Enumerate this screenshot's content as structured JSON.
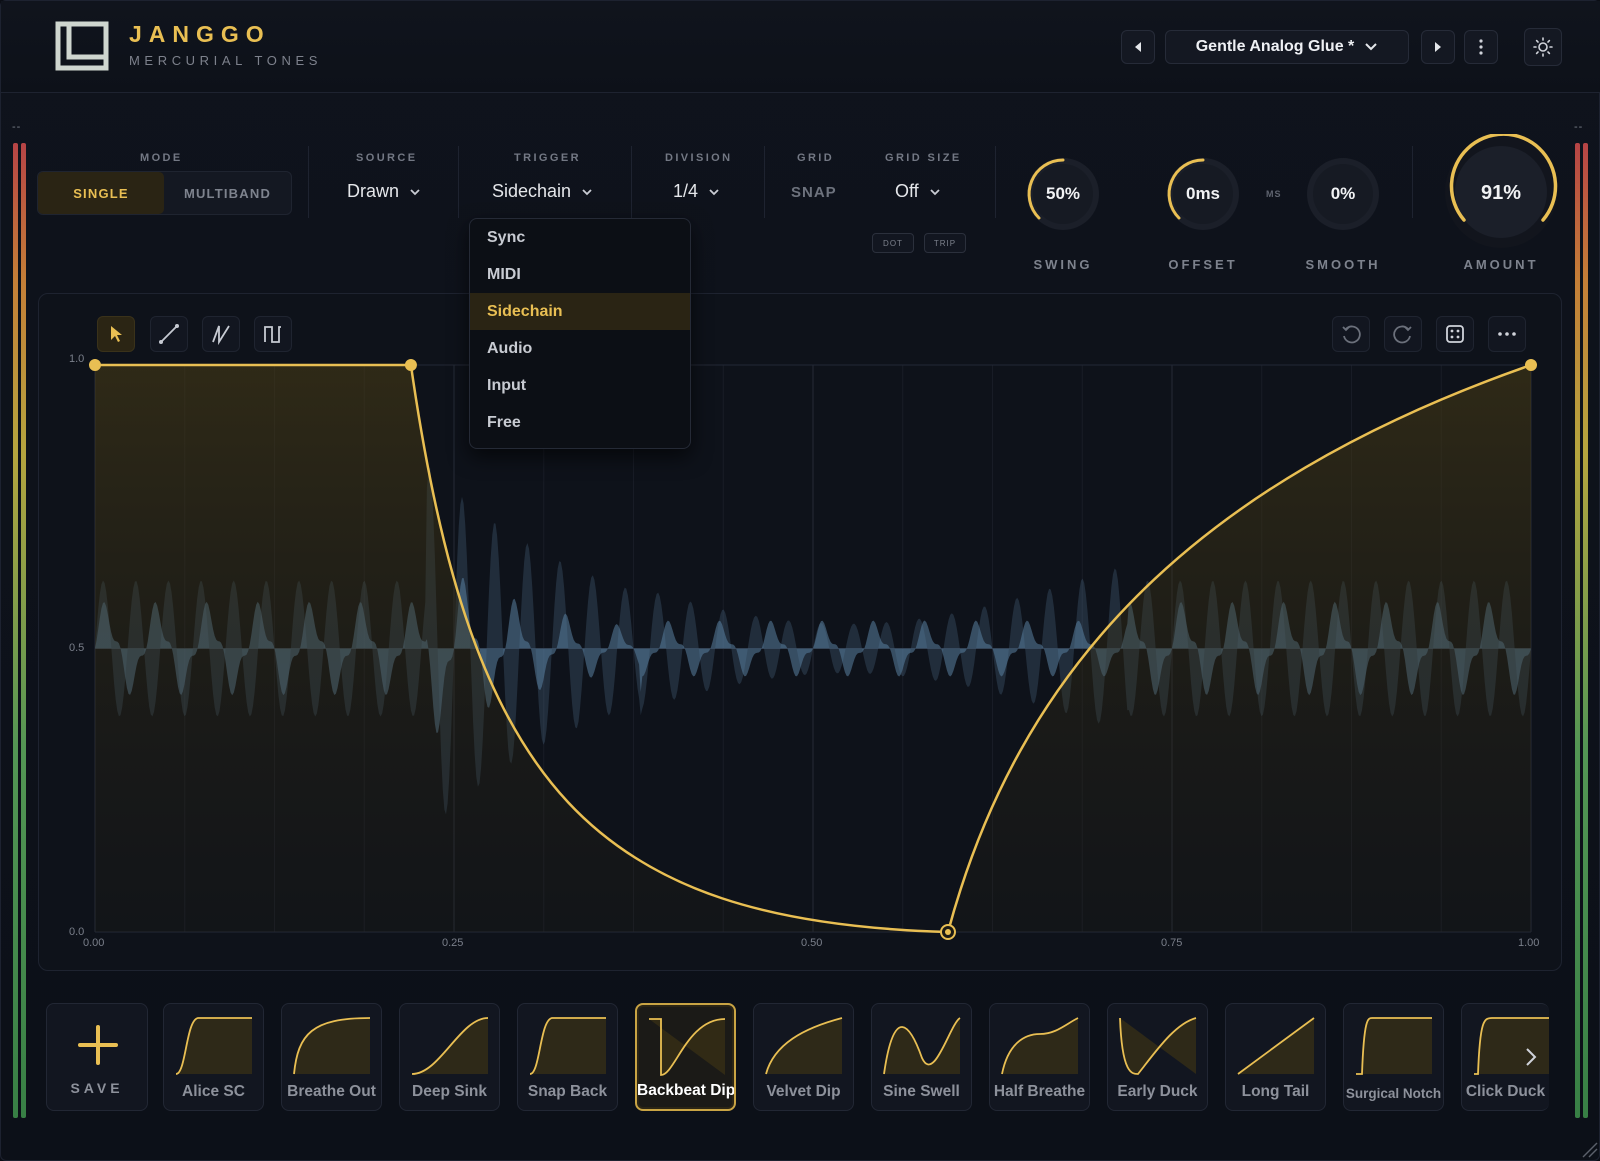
{
  "app": {
    "name": "JANGGO",
    "subtitle": "MERCURIAL TONES"
  },
  "header": {
    "preset_name": "Gentle Analog Glue *",
    "icons": [
      "prev-preset-icon",
      "chevron-down-icon",
      "next-preset-icon",
      "more-vertical-icon",
      "theme-sun-icon"
    ]
  },
  "meters": {
    "left_label": "--",
    "right_label": "--"
  },
  "controls": {
    "mode": {
      "label": "MODE",
      "options": [
        "SINGLE",
        "MULTIBAND"
      ],
      "selected": "SINGLE"
    },
    "source": {
      "label": "SOURCE",
      "value": "Drawn"
    },
    "trigger": {
      "label": "TRIGGER",
      "value": "Sidechain"
    },
    "division": {
      "label": "DIVISION",
      "value": "1/4"
    },
    "grid": {
      "label": "GRID",
      "value": "SNAP"
    },
    "grid_size": {
      "label": "GRID SIZE",
      "value": "Off",
      "dot": "DOT",
      "trip": "TRIP"
    },
    "swing": {
      "label": "SWING",
      "value": "50%",
      "level": 0.5
    },
    "offset": {
      "label": "OFFSET",
      "value": "0ms",
      "unit": "MS",
      "level": 0.5
    },
    "smooth": {
      "label": "SMOOTH",
      "value": "0%",
      "level": 0.0
    },
    "amount": {
      "label": "AMOUNT",
      "value": "91%",
      "level": 0.91
    }
  },
  "trigger_menu": {
    "items": [
      "Sync",
      "MIDI",
      "Sidechain",
      "Audio",
      "Input",
      "Free"
    ],
    "selected": "Sidechain"
  },
  "editor": {
    "tools": [
      "pointer-tool-icon",
      "line-tool-icon",
      "ramp-tool-icon",
      "square-tool-icon"
    ],
    "actions": [
      "undo-icon",
      "redo-icon",
      "random-dice-icon",
      "more-horizontal-icon"
    ],
    "y_ticks": [
      "1.0",
      "0.5",
      "0.0"
    ],
    "x_ticks": [
      "0.00",
      "0.25",
      "0.50",
      "0.75",
      "1.00"
    ],
    "curve_points": [
      {
        "x": 0.0,
        "y": 1.0
      },
      {
        "x": 0.22,
        "y": 1.0
      },
      {
        "x": 0.594,
        "y": 0.0
      },
      {
        "x": 1.0,
        "y": 1.0
      }
    ],
    "colors": {
      "accent": "#e9bf53",
      "wave": "#5a7fa0"
    }
  },
  "presets": {
    "save_label": "SAVE",
    "items": [
      {
        "name": "Alice SC",
        "shape": "rise-fast"
      },
      {
        "name": "Breathe Out",
        "shape": "rise-slow"
      },
      {
        "name": "Deep Sink",
        "shape": "s-curve"
      },
      {
        "name": "Snap Back",
        "shape": "rise-fast"
      },
      {
        "name": "Backbeat Dip",
        "shape": "dip"
      },
      {
        "name": "Velvet Dip",
        "shape": "rise-curve"
      },
      {
        "name": "Sine Swell",
        "shape": "sine"
      },
      {
        "name": "Half Breathe",
        "shape": "half"
      },
      {
        "name": "Early Duck",
        "shape": "duck"
      },
      {
        "name": "Long Tail",
        "shape": "ramp"
      },
      {
        "name": "Surgical Notch",
        "shape": "notch"
      },
      {
        "name": "Click Duck",
        "shape": "click"
      }
    ],
    "selected": "Backbeat Dip"
  }
}
